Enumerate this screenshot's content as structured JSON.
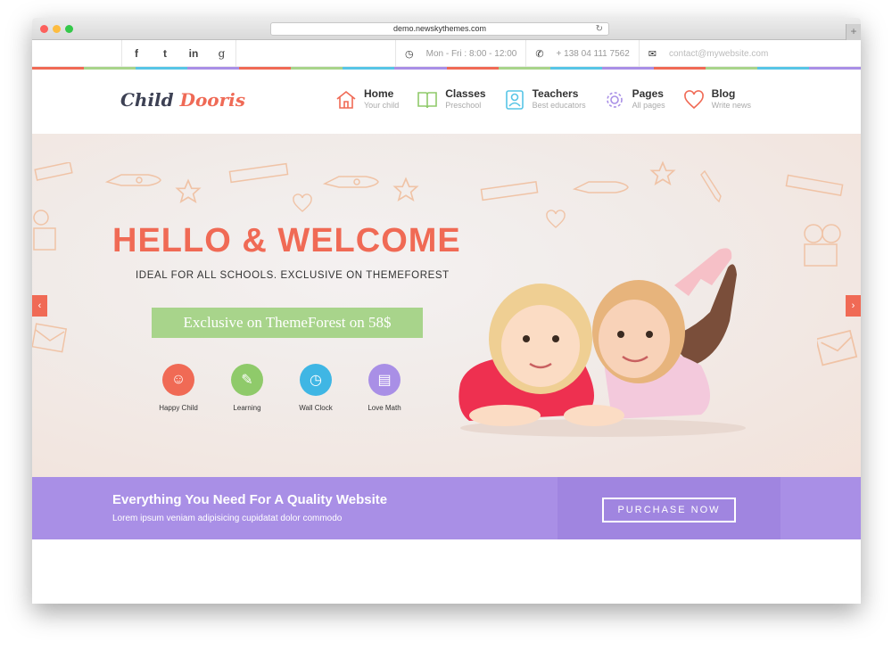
{
  "browser": {
    "url": "demo.newskythemes.com",
    "reload_glyph": "↻",
    "newtab_glyph": "+"
  },
  "topbar": {
    "social": [
      {
        "icon": "facebook-icon",
        "glyph": "f"
      },
      {
        "icon": "twitter-icon",
        "glyph": "t"
      },
      {
        "icon": "linkedin-icon",
        "glyph": "in"
      },
      {
        "icon": "google-plus-icon",
        "glyph": "g"
      }
    ],
    "hours": "Mon - Fri : 8:00 - 12:00",
    "phone": "+ 138 04 111 7562",
    "email_placeholder": "contact@mywebsite.com",
    "clock_glyph": "◷",
    "phone_glyph": "✆",
    "mail_glyph": "✉"
  },
  "rainbow_colors": [
    "#f06a55",
    "#a8d48b",
    "#57c5e6",
    "#a98fe6",
    "#f06a55",
    "#a8d48b",
    "#57c5e6",
    "#a98fe6",
    "#f06a55",
    "#a8d48b",
    "#57c5e6",
    "#a98fe6",
    "#f06a55",
    "#a8d48b",
    "#57c5e6",
    "#a98fe6"
  ],
  "logo": {
    "part1": "Child ",
    "part2": "Dooris"
  },
  "nav": [
    {
      "title": "Home",
      "sub": "Your child",
      "icon": "home-icon",
      "color": "#f06a55"
    },
    {
      "title": "Classes",
      "sub": "Preschool",
      "icon": "book-icon",
      "color": "#a8d48b"
    },
    {
      "title": "Teachers",
      "sub": "Best educators",
      "icon": "teacher-icon",
      "color": "#57c5e6"
    },
    {
      "title": "Pages",
      "sub": "All pages",
      "icon": "gear-icon",
      "color": "#a98fe6"
    },
    {
      "title": "Blog",
      "sub": "Write news",
      "icon": "heart-icon",
      "color": "#f06a55"
    }
  ],
  "hero": {
    "title": "HELLO & WELCOME",
    "subtitle": "IDEAL FOR ALL SCHOOLS. EXCLUSIVE ON THEMEFOREST",
    "button": "Exclusive on ThemeForest on 58$",
    "prev_glyph": "‹",
    "next_glyph": "›",
    "features": [
      {
        "label": "Happy Child",
        "icon": "happy-face-icon",
        "color": "#f06a55",
        "glyph": "☺"
      },
      {
        "label": "Learning",
        "icon": "pencil-ruler-icon",
        "color": "#8fca6a",
        "glyph": "✎"
      },
      {
        "label": "Wall Clock",
        "icon": "clock-icon",
        "color": "#3fb6e4",
        "glyph": "◷"
      },
      {
        "label": "Love Math",
        "icon": "chalkboard-icon",
        "color": "#a98fe6",
        "glyph": "▤"
      }
    ]
  },
  "cta": {
    "title": "Everything You Need For A Quality Website",
    "subtitle": "Lorem ipsum veniam adipisicing cupidatat dolor commodo",
    "button": "PURCHASE NOW"
  },
  "colors": {
    "accent": "#f06a55",
    "green": "#a8d48b",
    "blue": "#57c5e6",
    "purple": "#a98fe6"
  }
}
